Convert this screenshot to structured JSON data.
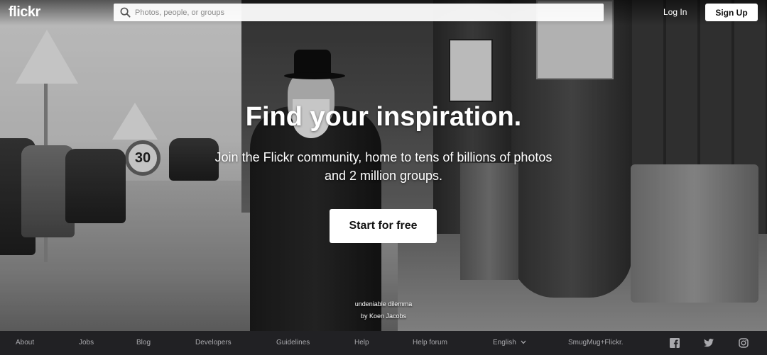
{
  "header": {
    "logo": "flickr",
    "search_placeholder": "Photos, people, or groups",
    "login_label": "Log In",
    "signup_label": "Sign Up"
  },
  "hero": {
    "title": "Find your inspiration.",
    "subtitle": "Join the Flickr community, home to tens of billions of photos and 2 million groups.",
    "cta_label": "Start for free"
  },
  "photo_credit": {
    "title": "undeniable dilemma",
    "author": "by Koen Jacobs"
  },
  "scene_sign_text": "30",
  "footer": {
    "links": [
      "About",
      "Jobs",
      "Blog",
      "Developers",
      "Guidelines",
      "Help",
      "Help forum"
    ],
    "language": "English",
    "smugmug": "SmugMug+Flickr.",
    "social_icons": [
      "facebook-icon",
      "twitter-icon",
      "instagram-icon"
    ]
  },
  "colors": {
    "footer_bg": "#212124",
    "footer_text": "#a9a9ad",
    "button_bg": "#ffffff"
  }
}
